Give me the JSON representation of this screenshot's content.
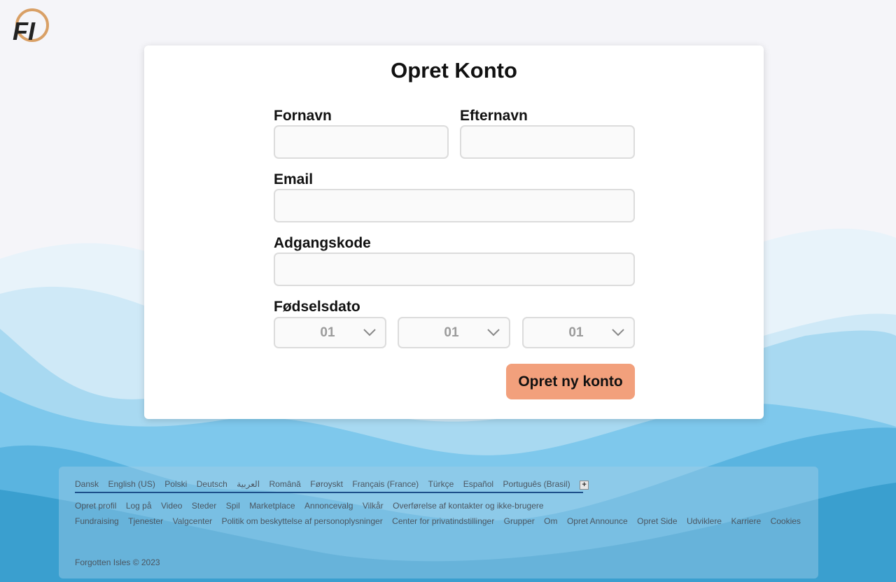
{
  "logo": {
    "text": "FI"
  },
  "form": {
    "title": "Opret Konto",
    "first_name_label": "Fornavn",
    "last_name_label": "Efternavn",
    "email_label": "Email",
    "password_label": "Adgangskode",
    "birthdate_label": "Fødselsdato",
    "day_value": "01",
    "month_value": "01",
    "year_value": "01",
    "submit_label": "Opret ny konto"
  },
  "footer": {
    "languages": [
      "Dansk",
      "English (US)",
      "Polski",
      "Deutsch",
      "العربية",
      "Română",
      "Føroyskt",
      "Français (France)",
      "Türkçe",
      "Español",
      "Português (Brasil)"
    ],
    "more_languages_label": "+",
    "links_row1": [
      "Opret profil",
      "Log på",
      "Video",
      "Steder",
      "Spil",
      "Marketplace",
      "Annoncevalg",
      "Vilkår",
      "Overførelse af kontakter og ikke-brugere"
    ],
    "links_row2": [
      "Fundraising",
      "Tjenester",
      "Valgcenter",
      "Politik om beskyttelse af personoplysninger",
      "Center for privatindstillinger",
      "Grupper",
      "Om",
      "Opret Announce",
      "Opret Side",
      "Udviklere",
      "Karriere",
      "Cookies"
    ],
    "copyright": "Forgotten Isles © 2023"
  },
  "colors": {
    "accent_button": "#f2a07c",
    "logo_ring": "#d9a066",
    "wave_dark": "#3a9fcf",
    "wave_light": "#bfe3f5"
  }
}
